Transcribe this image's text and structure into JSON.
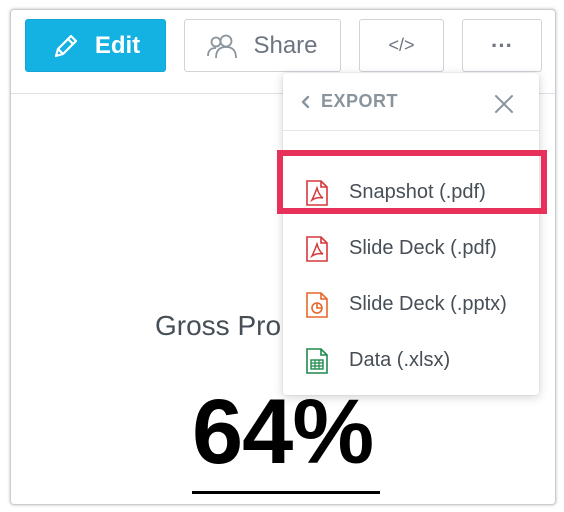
{
  "toolbar": {
    "edit_label": "Edit",
    "share_label": "Share",
    "embed_label": "</>",
    "more_label": "···"
  },
  "insight": {
    "title": "Gross Pro",
    "value": "64%"
  },
  "export_menu": {
    "back_label": "EXPORT",
    "items": [
      {
        "label": "Snapshot (.pdf)",
        "icon": "pdf-icon",
        "color": "#d6383a",
        "highlighted": true
      },
      {
        "label": "Slide Deck (.pdf)",
        "icon": "pdf-icon",
        "color": "#d6383a"
      },
      {
        "label": "Slide Deck (.pptx)",
        "icon": "pptx-icon",
        "color": "#e8672a"
      },
      {
        "label": "Data (.xlsx)",
        "icon": "xlsx-icon",
        "color": "#1f8a4c"
      }
    ]
  },
  "colors": {
    "edit_button": "#14b2e2",
    "highlight": "#e8315a"
  }
}
